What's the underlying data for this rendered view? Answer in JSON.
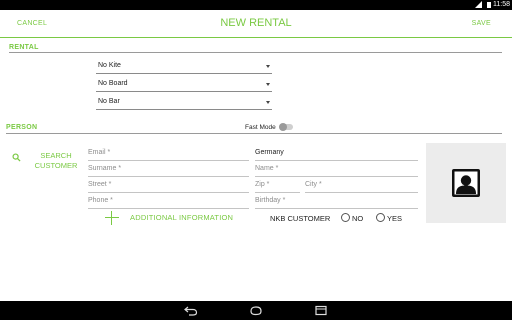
{
  "status_bar": {
    "time": "11:58"
  },
  "app_bar": {
    "cancel_label": "CANCEL",
    "title": "NEW RENTAL",
    "save_label": "SAVE",
    "accent_color": "#7ac943"
  },
  "rental": {
    "section_label": "RENTAL",
    "kite": "No Kite",
    "board": "No Board",
    "bar": "No Bar"
  },
  "person": {
    "section_label": "PERSON",
    "fast_mode_label": "Fast Mode",
    "fast_mode_on": false,
    "search_label": "SEARCH CUSTOMER",
    "fields": {
      "email_placeholder": "Email *",
      "country_value": "Germany",
      "surname_placeholder": "Surname *",
      "name_placeholder": "Name *",
      "street_placeholder": "Street *",
      "zip_placeholder": "Zip *",
      "city_placeholder": "City *",
      "phone_placeholder": "Phone *",
      "birthday_placeholder": "Birthday *"
    },
    "additional_info_label": "ADDITIONAL INFORMATION",
    "nkb_customer_label": "NKB CUSTOMER",
    "nkb_options": [
      "NO",
      "YES"
    ],
    "avatar_icon": "person-placeholder-icon"
  },
  "nav_bar": {
    "icons": [
      "back-icon",
      "home-icon",
      "recents-icon"
    ]
  }
}
